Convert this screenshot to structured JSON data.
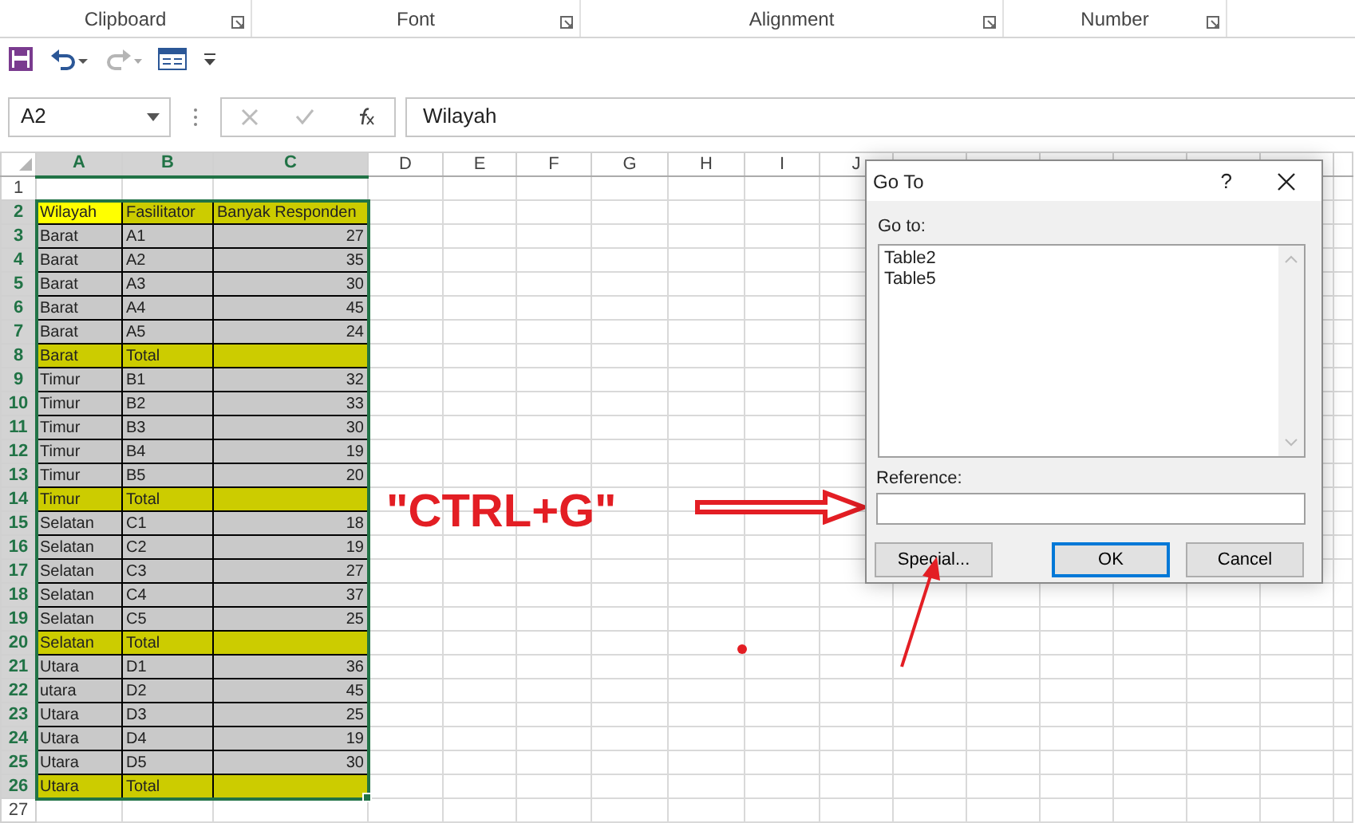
{
  "ribbon_groups": [
    {
      "label": "Clipboard"
    },
    {
      "label": "Font"
    },
    {
      "label": "Alignment"
    },
    {
      "label": "Number"
    }
  ],
  "quick_access": [
    {
      "kind": "save",
      "disabled": false
    },
    {
      "kind": "undo",
      "disabled": false
    },
    {
      "kind": "redo",
      "disabled": true
    },
    {
      "kind": "form",
      "disabled": false
    },
    {
      "kind": "customize",
      "disabled": false
    }
  ],
  "formula_bar": {
    "name_box": "A2",
    "formula": "Wilayah"
  },
  "columns": [
    {
      "label": "A",
      "selected": true
    },
    {
      "label": "B",
      "selected": true
    },
    {
      "label": "C",
      "selected": true
    },
    {
      "label": "D",
      "selected": false
    },
    {
      "label": "E",
      "selected": false
    },
    {
      "label": "F",
      "selected": false
    },
    {
      "label": "G",
      "selected": false
    },
    {
      "label": "H",
      "selected": false
    },
    {
      "label": "I",
      "selected": false
    },
    {
      "label": "J",
      "selected": false
    }
  ],
  "rows": [
    {
      "number": "1",
      "selected": false,
      "kind": "empty",
      "cells": []
    },
    {
      "number": "2",
      "selected": true,
      "kind": "header",
      "cells": [
        "Wilayah",
        "Fasilitator",
        "Banyak Responden"
      ]
    },
    {
      "number": "3",
      "selected": true,
      "kind": "data",
      "cells": [
        "Barat",
        "A1",
        "27"
      ]
    },
    {
      "number": "4",
      "selected": true,
      "kind": "data",
      "cells": [
        "Barat",
        "A2",
        "35"
      ]
    },
    {
      "number": "5",
      "selected": true,
      "kind": "data",
      "cells": [
        "Barat",
        "A3",
        "30"
      ]
    },
    {
      "number": "6",
      "selected": true,
      "kind": "data",
      "cells": [
        "Barat",
        "A4",
        "45"
      ]
    },
    {
      "number": "7",
      "selected": true,
      "kind": "data",
      "cells": [
        "Barat",
        "A5",
        "24"
      ]
    },
    {
      "number": "8",
      "selected": true,
      "kind": "total",
      "cells": [
        "Barat",
        "Total"
      ]
    },
    {
      "number": "9",
      "selected": true,
      "kind": "data",
      "cells": [
        "Timur",
        "B1",
        "32"
      ]
    },
    {
      "number": "10",
      "selected": true,
      "kind": "data",
      "cells": [
        "Timur",
        "B2",
        "33"
      ]
    },
    {
      "number": "11",
      "selected": true,
      "kind": "data",
      "cells": [
        "Timur",
        "B3",
        "30"
      ]
    },
    {
      "number": "12",
      "selected": true,
      "kind": "data",
      "cells": [
        "Timur",
        "B4",
        "19"
      ]
    },
    {
      "number": "13",
      "selected": true,
      "kind": "data",
      "cells": [
        "Timur",
        "B5",
        "20"
      ]
    },
    {
      "number": "14",
      "selected": true,
      "kind": "total",
      "cells": [
        "Timur",
        "Total"
      ]
    },
    {
      "number": "15",
      "selected": true,
      "kind": "data",
      "cells": [
        "Selatan",
        "C1",
        "18"
      ]
    },
    {
      "number": "16",
      "selected": true,
      "kind": "data",
      "cells": [
        "Selatan",
        "C2",
        "19"
      ]
    },
    {
      "number": "17",
      "selected": true,
      "kind": "data",
      "cells": [
        "Selatan",
        "C3",
        "27"
      ]
    },
    {
      "number": "18",
      "selected": true,
      "kind": "data",
      "cells": [
        "Selatan",
        "C4",
        "37"
      ]
    },
    {
      "number": "19",
      "selected": true,
      "kind": "data",
      "cells": [
        "Selatan",
        "C5",
        "25"
      ]
    },
    {
      "number": "20",
      "selected": true,
      "kind": "total",
      "cells": [
        "Selatan",
        "Total"
      ]
    },
    {
      "number": "21",
      "selected": true,
      "kind": "data",
      "cells": [
        "Utara",
        "D1",
        "36"
      ]
    },
    {
      "number": "22",
      "selected": true,
      "kind": "data",
      "cells": [
        "utara",
        "D2",
        "45"
      ]
    },
    {
      "number": "23",
      "selected": true,
      "kind": "data",
      "cells": [
        "Utara",
        "D3",
        "25"
      ]
    },
    {
      "number": "24",
      "selected": true,
      "kind": "data",
      "cells": [
        "Utara",
        "D4",
        "19"
      ]
    },
    {
      "number": "25",
      "selected": true,
      "kind": "data",
      "cells": [
        "Utara",
        "D5",
        "30"
      ]
    },
    {
      "number": "26",
      "selected": true,
      "kind": "total",
      "cells": [
        "Utara",
        "Total"
      ]
    },
    {
      "number": "27",
      "selected": false,
      "kind": "empty",
      "cells": []
    }
  ],
  "dialog": {
    "title": "Go To",
    "help": "?",
    "list_label": "Go to:",
    "list_items": [
      "Table2",
      "Table5"
    ],
    "reference_label": "Reference:",
    "buttons": [
      {
        "label": "Special...",
        "default": false
      },
      {
        "label": "OK",
        "default": true
      },
      {
        "label": "Cancel",
        "default": false
      }
    ]
  },
  "annotation": {
    "text": "\"CTRL+G\""
  }
}
